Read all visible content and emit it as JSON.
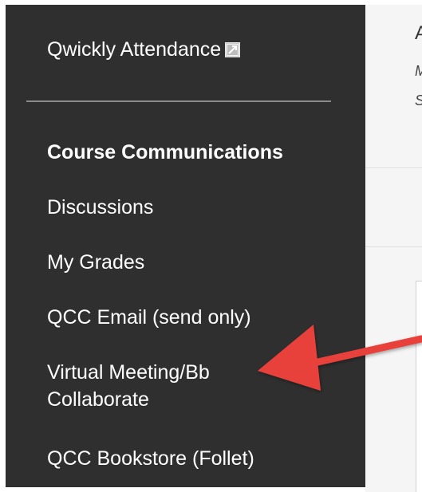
{
  "sidebar": {
    "tool_link": {
      "label": "Qwickly Attendance",
      "icon": "external-link-icon"
    },
    "section_heading": "Course Communications",
    "items": [
      {
        "label": "Discussions"
      },
      {
        "label": "My Grades"
      },
      {
        "label": "QCC Email (send only)"
      },
      {
        "label": "Virtual Meeting/Bb",
        "label_line2": "Collaborate"
      },
      {
        "label": "QCC Bookstore (Follet)"
      }
    ]
  },
  "main": {
    "heading": "A",
    "sublines": [
      "M",
      "S"
    ]
  },
  "annotation": {
    "arrow_color": "#e8403a"
  },
  "colors": {
    "sidebar_bg": "#2f2f2f",
    "sidebar_text": "#ffffff",
    "separator": "#8a8a8a"
  }
}
